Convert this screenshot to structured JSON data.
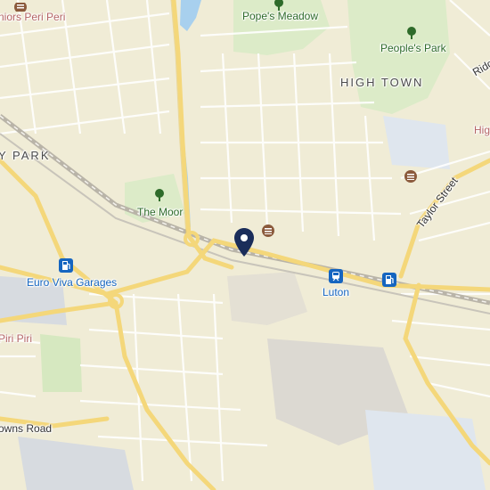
{
  "map": {
    "colors": {
      "background": "#f0ecd6",
      "park": "#dcebc8",
      "water": "#a8d0ee",
      "major_road": "#f4d77a",
      "minor_road": "#ffffff",
      "railway": "#b9b4a8",
      "transit_blue": "#1565c0",
      "marker": "#1a2d5a",
      "restaurant": "#8b5a3c"
    },
    "labels": {
      "park_popes_meadow": "Pope's Meadow",
      "park_peoples_park": "People's Park",
      "park_the_moor": "The Moor",
      "district_high_town": "HIGH TOWN",
      "district_park": "Y PARK",
      "restaurant_top": "niors Peri Peri",
      "restaurant_left": "Piri Piri",
      "fuel_station": "Euro Viva Garages",
      "station": "Luton",
      "road_taylor": "Taylor Street",
      "road_ridge": "Ridge",
      "road_downs": "owns Road",
      "place_high": "High"
    },
    "icons": {
      "marker": "location-pin-icon",
      "fuel": "fuel-pump-icon",
      "train": "train-station-icon",
      "food": "burger-icon",
      "tree": "tree-icon"
    }
  }
}
